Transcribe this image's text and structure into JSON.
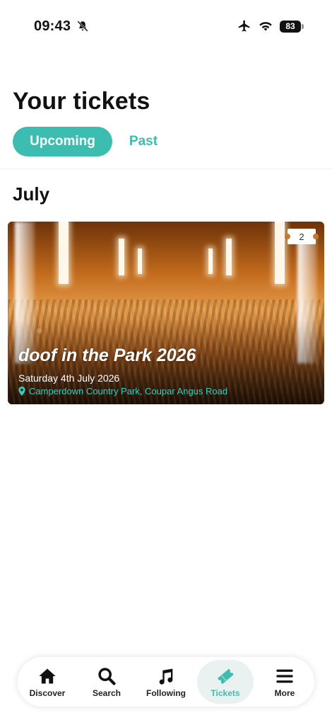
{
  "status_bar": {
    "time": "09:43",
    "battery": "83",
    "icons": [
      "bell-slash-icon",
      "airplane-icon",
      "wifi-icon",
      "battery-icon"
    ]
  },
  "header": {
    "title": "Your tickets",
    "tabs": [
      {
        "label": "Upcoming",
        "active": true
      },
      {
        "label": "Past",
        "active": false
      }
    ]
  },
  "sections": [
    {
      "month": "July",
      "events": [
        {
          "title": "doof in the Park 2026",
          "date": "Saturday 4th July 2026",
          "venue": "Camperdown Country Park, Coupar Angus Road",
          "ticket_count": "2",
          "icon": "location-pin-icon"
        }
      ]
    }
  ],
  "bottom_nav": {
    "items": [
      {
        "label": "Discover",
        "icon": "home-icon",
        "active": false
      },
      {
        "label": "Search",
        "icon": "search-icon",
        "active": false
      },
      {
        "label": "Following",
        "icon": "music-note-icon",
        "active": false
      },
      {
        "label": "Tickets",
        "icon": "ticket-icon",
        "active": true
      },
      {
        "label": "More",
        "icon": "menu-icon",
        "active": false
      }
    ]
  },
  "colors": {
    "accent": "#3dbdb0",
    "active_nav_bg": "#e9f2f1",
    "text": "#111111"
  }
}
